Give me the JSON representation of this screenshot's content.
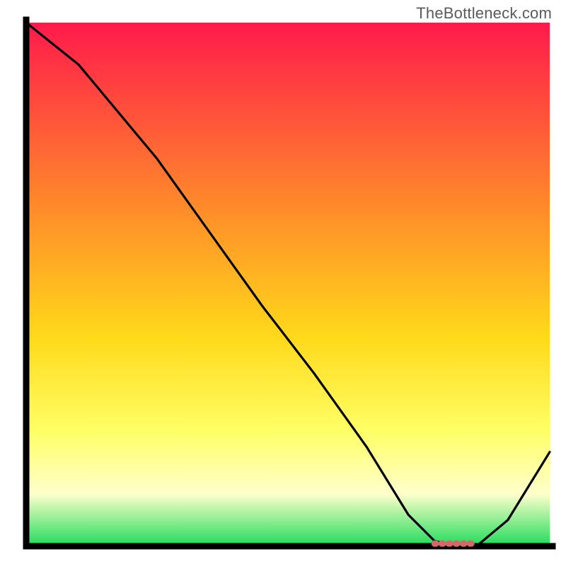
{
  "attribution": "TheBottleneck.com",
  "colors": {
    "axis": "#000000",
    "curve": "#000000",
    "marker_fill": "#d36a6a",
    "marker_stroke": "#c15a5a",
    "grad_top": "#ff1a4b",
    "grad_mid1": "#ff8a2a",
    "grad_mid2": "#ffd91a",
    "grad_mid3": "#ffff66",
    "grad_pale": "#ffffcc",
    "grad_green": "#1fdc5a"
  },
  "chart_data": {
    "type": "line",
    "title": "",
    "xlabel": "",
    "ylabel": "",
    "xlim": [
      0,
      100
    ],
    "ylim": [
      0,
      100
    ],
    "grid": false,
    "legend": false,
    "x": [
      0,
      10,
      20,
      25,
      35,
      45,
      55,
      65,
      73,
      78,
      82,
      86,
      92,
      100
    ],
    "values": [
      100,
      92,
      80,
      74,
      60,
      46,
      33,
      19,
      6,
      1,
      0,
      0,
      5,
      18
    ],
    "optimum_marker": {
      "x_start": 78,
      "x_end": 86,
      "y": 0.5
    }
  }
}
